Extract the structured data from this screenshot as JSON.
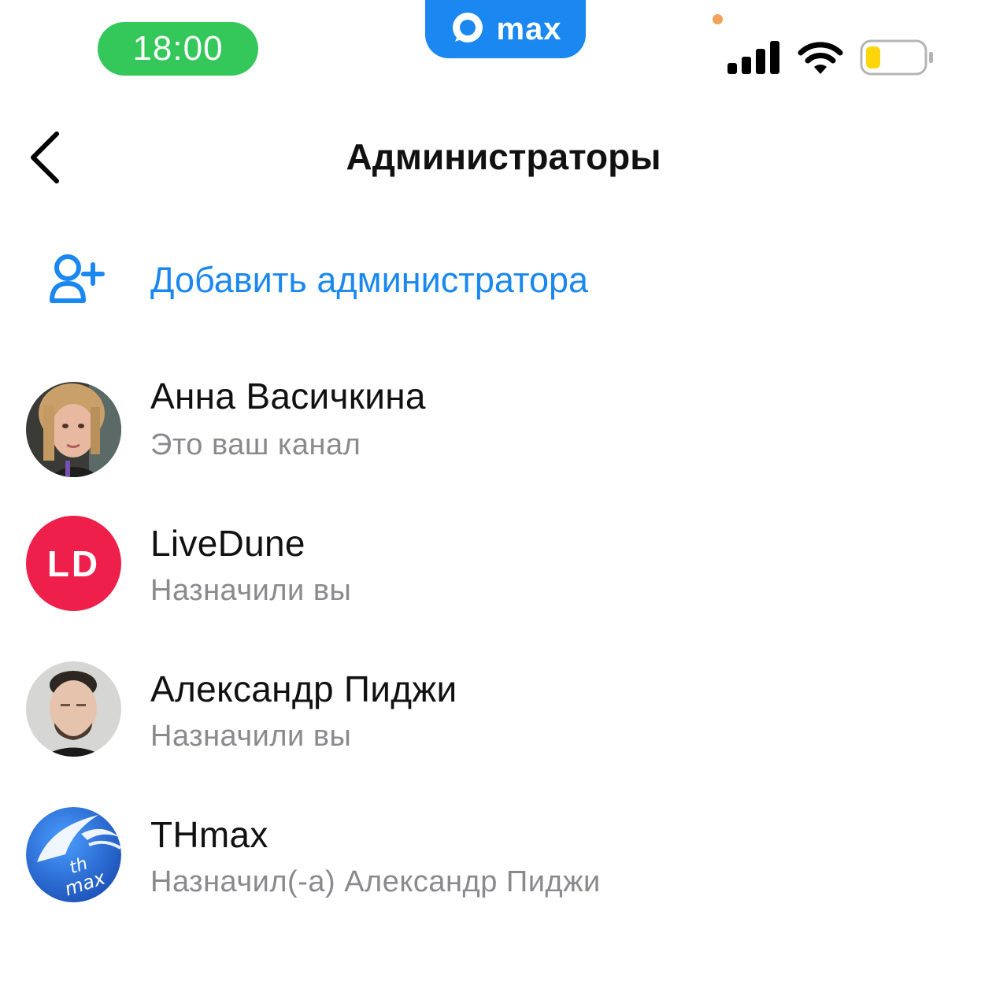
{
  "status_bar": {
    "time": "18:00",
    "app_name": "max",
    "colors": {
      "time_pill": "#34c759",
      "app_pill": "#1a88f0",
      "battery_level": "#ffd60a"
    }
  },
  "header": {
    "title": "Администраторы"
  },
  "add_admin": {
    "label": "Добавить администратора"
  },
  "admins": [
    {
      "name": "Анна Васичкина",
      "subtitle": "Это ваш канал",
      "avatar": "photo-woman"
    },
    {
      "name": "LiveDune",
      "subtitle": "Назначили вы",
      "avatar_initials": "LD",
      "avatar_color": "#ee1f4b"
    },
    {
      "name": "Александр Пиджи",
      "subtitle": "Назначили вы",
      "avatar": "photo-man"
    },
    {
      "name": "THmax",
      "subtitle": "Назначил(-а) Александр Пиджи",
      "avatar_logo_text": [
        "th",
        "max"
      ],
      "avatar_color": "#2b6fd6"
    }
  ],
  "accent_color": "#1a88f0"
}
